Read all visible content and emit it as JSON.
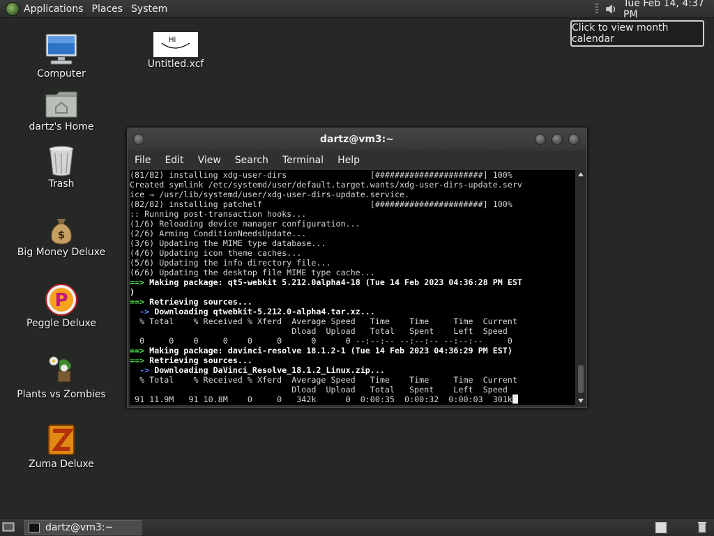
{
  "top_panel": {
    "menus": [
      "Applications",
      "Places",
      "System"
    ],
    "clock": "Tue Feb 14,  4:37 PM"
  },
  "tooltip": "Click to view month calendar",
  "desktop_icons": {
    "computer": "Computer",
    "untitled": "Untitled.xcf",
    "home": "dartz's Home",
    "trash": "Trash",
    "big_money": "Big Money Deluxe",
    "peggle": "Peggle Deluxe",
    "pvz": "Plants vs Zombies",
    "zuma": "Zuma Deluxe",
    "untitled_thumb_text": "Hi"
  },
  "terminal": {
    "title": "dartz@vm3:~",
    "menu": [
      "File",
      "Edit",
      "View",
      "Search",
      "Terminal",
      "Help"
    ],
    "lines": [
      "(81/82) installing xdg-user-dirs                 [######################] 100%",
      "Created symlink /etc/systemd/user/default.target.wants/xdg-user-dirs-update.serv",
      "ice → /usr/lib/systemd/user/xdg-user-dirs-update.service.",
      "(82/82) installing patchelf                      [######################] 100%",
      ":: Running post-transaction hooks...",
      "(1/6) Reloading device manager configuration...",
      "(2/6) Arming ConditionNeedsUpdate...",
      "(3/6) Updating the MIME type database...",
      "(4/6) Updating icon theme caches...",
      "(5/6) Updating the info directory file...",
      "(6/6) Updating the desktop file MIME type cache...",
      "Making package: qt5-webkit 5.212.0alpha4-18 (Tue 14 Feb 2023 04:36:28 PM EST",
      ")",
      "Retrieving sources...",
      "Downloading qtwebkit-5.212.0-alpha4.tar.xz...",
      "  % Total    % Received % Xferd  Average Speed   Time    Time     Time  Current",
      "                                 Dload  Upload   Total   Spent    Left  Speed",
      "  0     0    0     0    0     0      0      0 --:--:-- --:--:-- --:--:--     0",
      "Making package: davinci-resolve 18.1.2-1 (Tue 14 Feb 2023 04:36:29 PM EST)",
      "Retrieving sources...",
      "Downloading DaVinci_Resolve_18.1.2_Linux.zip...",
      "  % Total    % Received % Xferd  Average Speed   Time    Time     Time  Current",
      "                                 Dload  Upload   Total   Spent    Left  Speed",
      " 91 11.9M   91 10.8M    0     0   342k      0  0:00:35  0:00:32  0:00:03  301k"
    ],
    "prefix_arrow": "==> ",
    "prefix_sub": "  -> "
  },
  "taskbar": {
    "window_button": "dartz@vm3:~"
  }
}
